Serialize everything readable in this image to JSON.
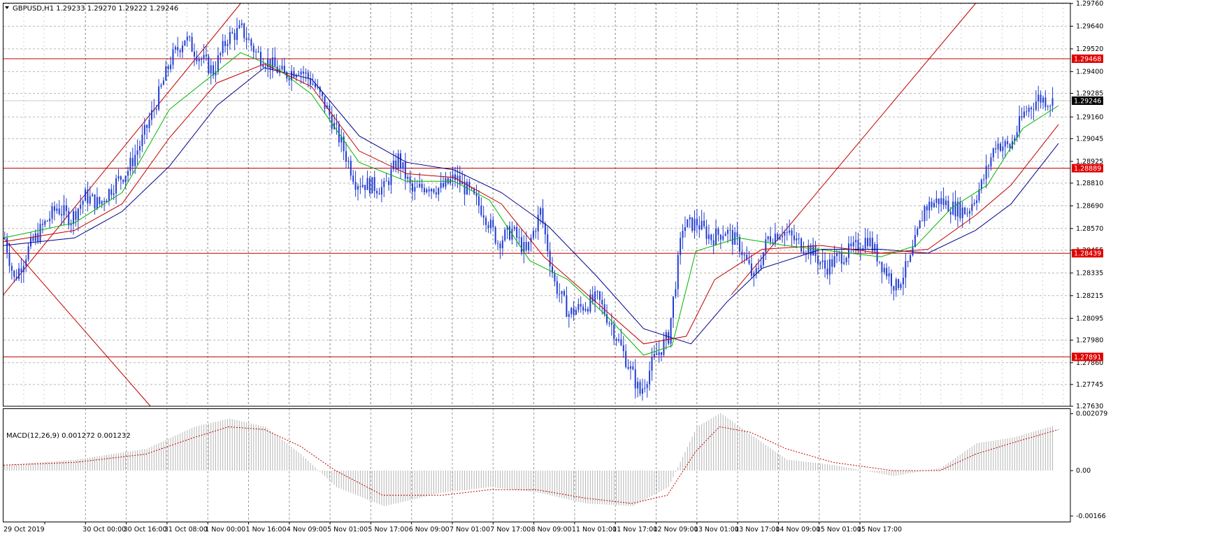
{
  "symbol_header": "GBPUSD,H1  1.29233 1.29270 1.29222 1.29246",
  "macd_header": "MACD(12,26,9) 0.001272 0.001232",
  "colors": {
    "candle": "#1f3bd1",
    "ma_fast": "#00b400",
    "ma_mid": "#c00000",
    "ma_slow": "#00008c",
    "hline": "#c00000",
    "trendline": "#c00000",
    "label_red": "#e00000",
    "label_black": "#000000",
    "macd_hist": "#b4b4b4",
    "macd_signal": "#c00000",
    "grid": "#9a9a9a"
  },
  "chart_data": [
    {
      "type": "candlestick",
      "symbol": "GBPUSD",
      "timeframe": "H1",
      "ylim": [
        1.2763,
        1.2976
      ],
      "y_ticks": [
        "1.29760",
        "1.29640",
        "1.29520",
        "1.29400",
        "1.29285",
        "1.29160",
        "1.29045",
        "1.28925",
        "1.28810",
        "1.28690",
        "1.28570",
        "1.28455",
        "1.28335",
        "1.28215",
        "1.28095",
        "1.27980",
        "1.27860",
        "1.27745",
        "1.27630"
      ],
      "x_ticks": [
        "29 Oct 2019",
        "30 Oct 00:00",
        "30 Oct 16:00",
        "31 Oct 08:00",
        "1 Nov 00:00",
        "1 Nov 16:00",
        "4 Nov 09:00",
        "5 Nov 01:00",
        "5 Nov 17:00",
        "6 Nov 09:00",
        "7 Nov 01:00",
        "7 Nov 17:00",
        "8 Nov 09:00",
        "11 Nov 01:00",
        "11 Nov 17:00",
        "12 Nov 09:00",
        "13 Nov 01:00",
        "13 Nov 17:00",
        "14 Nov 09:00",
        "15 Nov 01:00",
        "15 Nov 17:00"
      ],
      "price_levels": [
        {
          "value": 1.29468,
          "label": "1.29468",
          "style": "red"
        },
        {
          "value": 1.29246,
          "label": "1.29246",
          "style": "black"
        },
        {
          "value": 1.28889,
          "label": "1.28889",
          "style": "red"
        },
        {
          "value": 1.28439,
          "label": "1.28439",
          "style": "red"
        },
        {
          "value": 1.27891,
          "label": "1.27891",
          "style": "red"
        }
      ],
      "close_path": [
        [
          0,
          1.2852
        ],
        [
          4,
          1.283
        ],
        [
          10,
          1.2846
        ],
        [
          16,
          1.2858
        ],
        [
          22,
          1.2868
        ],
        [
          28,
          1.2862
        ],
        [
          34,
          1.2874
        ],
        [
          40,
          1.287
        ],
        [
          46,
          1.288
        ],
        [
          52,
          1.2888
        ],
        [
          58,
          1.2904
        ],
        [
          64,
          1.2924
        ],
        [
          70,
          1.2946
        ],
        [
          76,
          1.2958
        ],
        [
          82,
          1.2948
        ],
        [
          88,
          1.294
        ],
        [
          94,
          1.2958
        ],
        [
          100,
          1.2962
        ],
        [
          106,
          1.295
        ],
        [
          112,
          1.2944
        ],
        [
          118,
          1.2938
        ],
        [
          124,
          1.2942
        ],
        [
          130,
          1.2934
        ],
        [
          136,
          1.292
        ],
        [
          142,
          1.2902
        ],
        [
          148,
          1.2882
        ],
        [
          154,
          1.288
        ],
        [
          160,
          1.2878
        ],
        [
          166,
          1.2894
        ],
        [
          172,
          1.2876
        ],
        [
          178,
          1.288
        ],
        [
          184,
          1.2878
        ],
        [
          190,
          1.2884
        ],
        [
          196,
          1.2876
        ],
        [
          202,
          1.2866
        ],
        [
          208,
          1.285
        ],
        [
          214,
          1.2856
        ],
        [
          220,
          1.2844
        ],
        [
          226,
          1.2866
        ],
        [
          232,
          1.2828
        ],
        [
          238,
          1.2812
        ],
        [
          244,
          1.2816
        ],
        [
          250,
          1.282
        ],
        [
          256,
          1.2806
        ],
        [
          262,
          1.2788
        ],
        [
          268,
          1.277
        ],
        [
          274,
          1.2788
        ],
        [
          280,
          1.28
        ],
        [
          286,
          1.2858
        ],
        [
          292,
          1.286
        ],
        [
          298,
          1.2852
        ],
        [
          304,
          1.2856
        ],
        [
          310,
          1.2848
        ],
        [
          316,
          1.283
        ],
        [
          322,
          1.2852
        ],
        [
          328,
          1.2856
        ],
        [
          334,
          1.285
        ],
        [
          340,
          1.2846
        ],
        [
          346,
          1.2836
        ],
        [
          352,
          1.2842
        ],
        [
          358,
          1.2846
        ],
        [
          364,
          1.2852
        ],
        [
          370,
          1.2838
        ],
        [
          376,
          1.2826
        ],
        [
          382,
          1.284
        ],
        [
          388,
          1.2868
        ],
        [
          394,
          1.2872
        ],
        [
          400,
          1.2868
        ],
        [
          406,
          1.2866
        ],
        [
          412,
          1.288
        ],
        [
          418,
          1.2902
        ],
        [
          424,
          1.29
        ],
        [
          430,
          1.2918
        ],
        [
          436,
          1.2926
        ],
        [
          442,
          1.2924
        ]
      ],
      "ma_fast_path": [
        [
          0,
          1.2852
        ],
        [
          30,
          1.286
        ],
        [
          50,
          1.2876
        ],
        [
          70,
          1.292
        ],
        [
          90,
          1.294
        ],
        [
          100,
          1.295
        ],
        [
          115,
          1.2942
        ],
        [
          130,
          1.2928
        ],
        [
          150,
          1.2892
        ],
        [
          170,
          1.2882
        ],
        [
          190,
          1.2882
        ],
        [
          205,
          1.2872
        ],
        [
          222,
          1.284
        ],
        [
          238,
          1.283
        ],
        [
          255,
          1.281
        ],
        [
          270,
          1.279
        ],
        [
          282,
          1.2795
        ],
        [
          292,
          1.2845
        ],
        [
          310,
          1.2852
        ],
        [
          330,
          1.2848
        ],
        [
          350,
          1.2845
        ],
        [
          370,
          1.2842
        ],
        [
          385,
          1.2848
        ],
        [
          400,
          1.2868
        ],
        [
          415,
          1.288
        ],
        [
          430,
          1.291
        ],
        [
          445,
          1.2922
        ]
      ],
      "ma_mid_path": [
        [
          0,
          1.285
        ],
        [
          30,
          1.2856
        ],
        [
          50,
          1.287
        ],
        [
          70,
          1.2905
        ],
        [
          90,
          1.2934
        ],
        [
          110,
          1.2944
        ],
        [
          130,
          1.2932
        ],
        [
          150,
          1.2898
        ],
        [
          170,
          1.2886
        ],
        [
          190,
          1.2884
        ],
        [
          210,
          1.287
        ],
        [
          228,
          1.2842
        ],
        [
          250,
          1.2818
        ],
        [
          270,
          1.2796
        ],
        [
          288,
          1.28
        ],
        [
          300,
          1.283
        ],
        [
          320,
          1.2846
        ],
        [
          345,
          1.2848
        ],
        [
          370,
          1.2844
        ],
        [
          390,
          1.2846
        ],
        [
          410,
          1.2864
        ],
        [
          425,
          1.288
        ],
        [
          445,
          1.2912
        ]
      ],
      "ma_slow_path": [
        [
          0,
          1.2848
        ],
        [
          30,
          1.2852
        ],
        [
          50,
          1.2866
        ],
        [
          70,
          1.289
        ],
        [
          90,
          1.2922
        ],
        [
          110,
          1.2942
        ],
        [
          130,
          1.2936
        ],
        [
          150,
          1.2906
        ],
        [
          170,
          1.2892
        ],
        [
          190,
          1.2888
        ],
        [
          210,
          1.2876
        ],
        [
          230,
          1.2858
        ],
        [
          250,
          1.2832
        ],
        [
          270,
          1.2804
        ],
        [
          290,
          1.2796
        ],
        [
          305,
          1.2818
        ],
        [
          320,
          1.2836
        ],
        [
          345,
          1.2846
        ],
        [
          370,
          1.2846
        ],
        [
          390,
          1.2844
        ],
        [
          410,
          1.2856
        ],
        [
          425,
          1.287
        ],
        [
          445,
          1.2902
        ]
      ]
    },
    {
      "type": "bar+line",
      "indicator": "MACD(12,26,9)",
      "ylim": [
        -0.00166,
        0.00207
      ],
      "y_ticks": [
        "0.002079",
        "0.00",
        "-0.00166"
      ],
      "histogram": [
        [
          0,
          0.0002
        ],
        [
          30,
          0.0004
        ],
        [
          60,
          0.0008
        ],
        [
          80,
          0.0016
        ],
        [
          95,
          0.0019
        ],
        [
          110,
          0.0016
        ],
        [
          125,
          0.0006
        ],
        [
          140,
          -0.0006
        ],
        [
          160,
          -0.0013
        ],
        [
          185,
          -0.0008
        ],
        [
          205,
          -0.0006
        ],
        [
          225,
          -0.0008
        ],
        [
          245,
          -0.0012
        ],
        [
          265,
          -0.0013
        ],
        [
          280,
          -0.0006
        ],
        [
          292,
          0.0016
        ],
        [
          302,
          0.0021
        ],
        [
          315,
          0.0013
        ],
        [
          330,
          0.0004
        ],
        [
          350,
          0.0002
        ],
        [
          375,
          -0.0002
        ],
        [
          395,
          0.0001
        ],
        [
          410,
          0.001
        ],
        [
          425,
          0.0012
        ],
        [
          445,
          0.0017
        ]
      ],
      "signal": [
        [
          0,
          0.0002
        ],
        [
          30,
          0.0003
        ],
        [
          60,
          0.0006
        ],
        [
          80,
          0.0012
        ],
        [
          95,
          0.0016
        ],
        [
          110,
          0.0015
        ],
        [
          125,
          0.0009
        ],
        [
          140,
          0.0
        ],
        [
          160,
          -0.0009
        ],
        [
          185,
          -0.0009
        ],
        [
          205,
          -0.0007
        ],
        [
          225,
          -0.0007
        ],
        [
          245,
          -0.001
        ],
        [
          265,
          -0.0012
        ],
        [
          280,
          -0.0009
        ],
        [
          292,
          0.0007
        ],
        [
          302,
          0.0016
        ],
        [
          315,
          0.0014
        ],
        [
          330,
          0.0008
        ],
        [
          350,
          0.0003
        ],
        [
          375,
          0.0
        ],
        [
          395,
          0.0
        ],
        [
          410,
          0.0006
        ],
        [
          425,
          0.001
        ],
        [
          445,
          0.0015
        ]
      ]
    }
  ]
}
